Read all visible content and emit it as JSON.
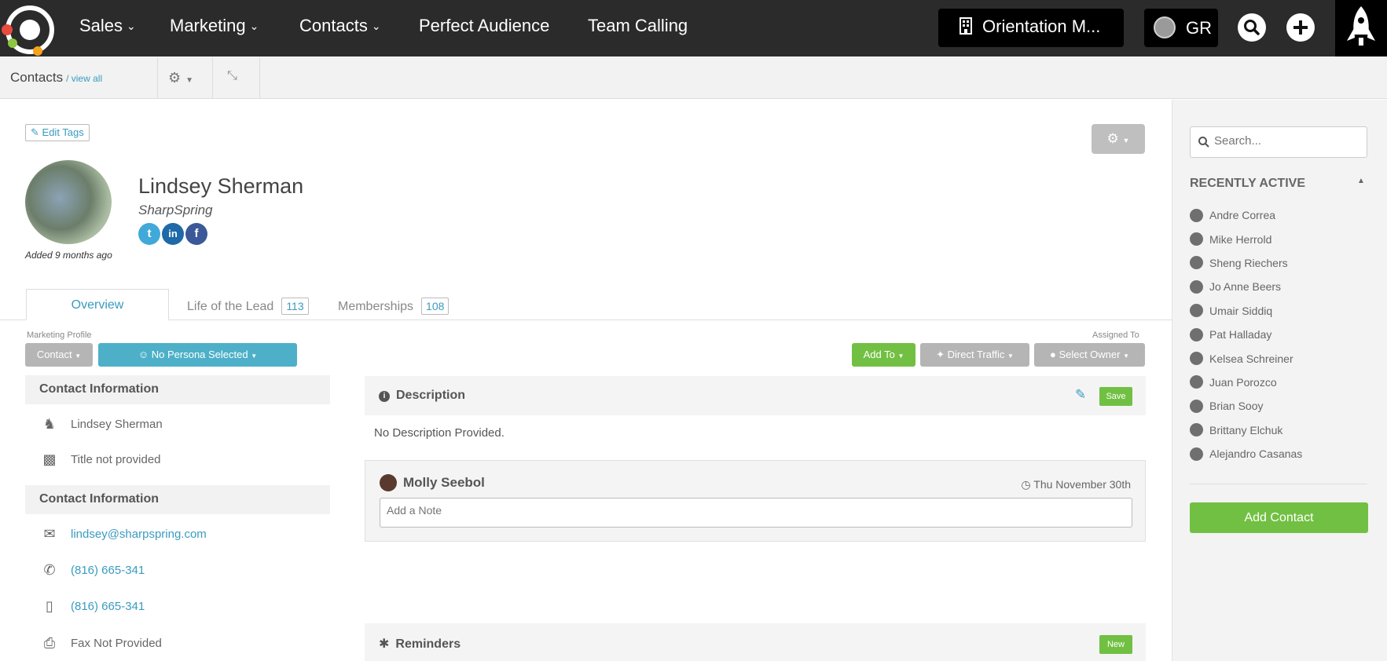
{
  "nav": {
    "items": [
      {
        "label": "Sales",
        "has_dropdown": true
      },
      {
        "label": "Marketing",
        "has_dropdown": true
      },
      {
        "label": "Contacts",
        "has_dropdown": true
      },
      {
        "label": "Perfect Audience",
        "has_dropdown": false
      },
      {
        "label": "Team Calling",
        "has_dropdown": false
      }
    ],
    "org_label": "Orientation M...",
    "user_initials": "GR",
    "icons": [
      "logo-icon",
      "building-icon",
      "search-icon",
      "plus-icon",
      "rocket-icon"
    ]
  },
  "subbar": {
    "title": "Contacts",
    "view_all": "/ view all"
  },
  "contact": {
    "edit_tags": "Edit Tags",
    "name": "Lindsey Sherman",
    "company": "SharpSpring",
    "added": "Added 9 months ago",
    "social": [
      "twitter",
      "linkedin",
      "facebook"
    ]
  },
  "tabs": [
    {
      "label": "Overview",
      "count": null
    },
    {
      "label": "Life of the Lead",
      "count": "113"
    },
    {
      "label": "Memberships",
      "count": "108"
    }
  ],
  "profile": {
    "marketing_profile_label": "Marketing Profile",
    "type_button": "Contact",
    "persona_button": "No Persona Selected",
    "assigned_to_label": "Assigned To",
    "add_to": "Add To",
    "direct_traffic": "Direct Traffic",
    "select_owner": "Select Owner"
  },
  "info": {
    "section1_title": "Contact Information",
    "full_name": "Lindsey Sherman",
    "title": "Title not provided",
    "section2_title": "Contact Information",
    "email": "lindsey@sharpspring.com",
    "phone": "(816) 665-341",
    "mobile": "(816) 665-341",
    "fax": "Fax Not Provided"
  },
  "description": {
    "title": "Description",
    "save": "Save",
    "text": "No Description Provided."
  },
  "note": {
    "author": "Molly Seebol",
    "date": "Thu November 30th",
    "placeholder": "Add a Note"
  },
  "reminders": {
    "title": "Reminders",
    "new": "New"
  },
  "sidebar": {
    "search_placeholder": "Search...",
    "recent_title": "RECENTLY ACTIVE",
    "recent": [
      "Andre Correa",
      "Mike Herrold",
      "Sheng Riechers",
      "Jo Anne Beers",
      "Umair Siddiq",
      "Pat Halladay",
      "Kelsea Schreiner",
      "Juan Porozco",
      "Brian Sooy",
      "Brittany Elchuk",
      "Alejandro Casanas"
    ],
    "add_contact": "Add Contact"
  },
  "colors": {
    "topbar": "#2b2b2b",
    "link": "#3a9bbf",
    "green": "#72c043",
    "persona_blue": "#4db0c8",
    "gray_button": "#b5b5b5"
  }
}
